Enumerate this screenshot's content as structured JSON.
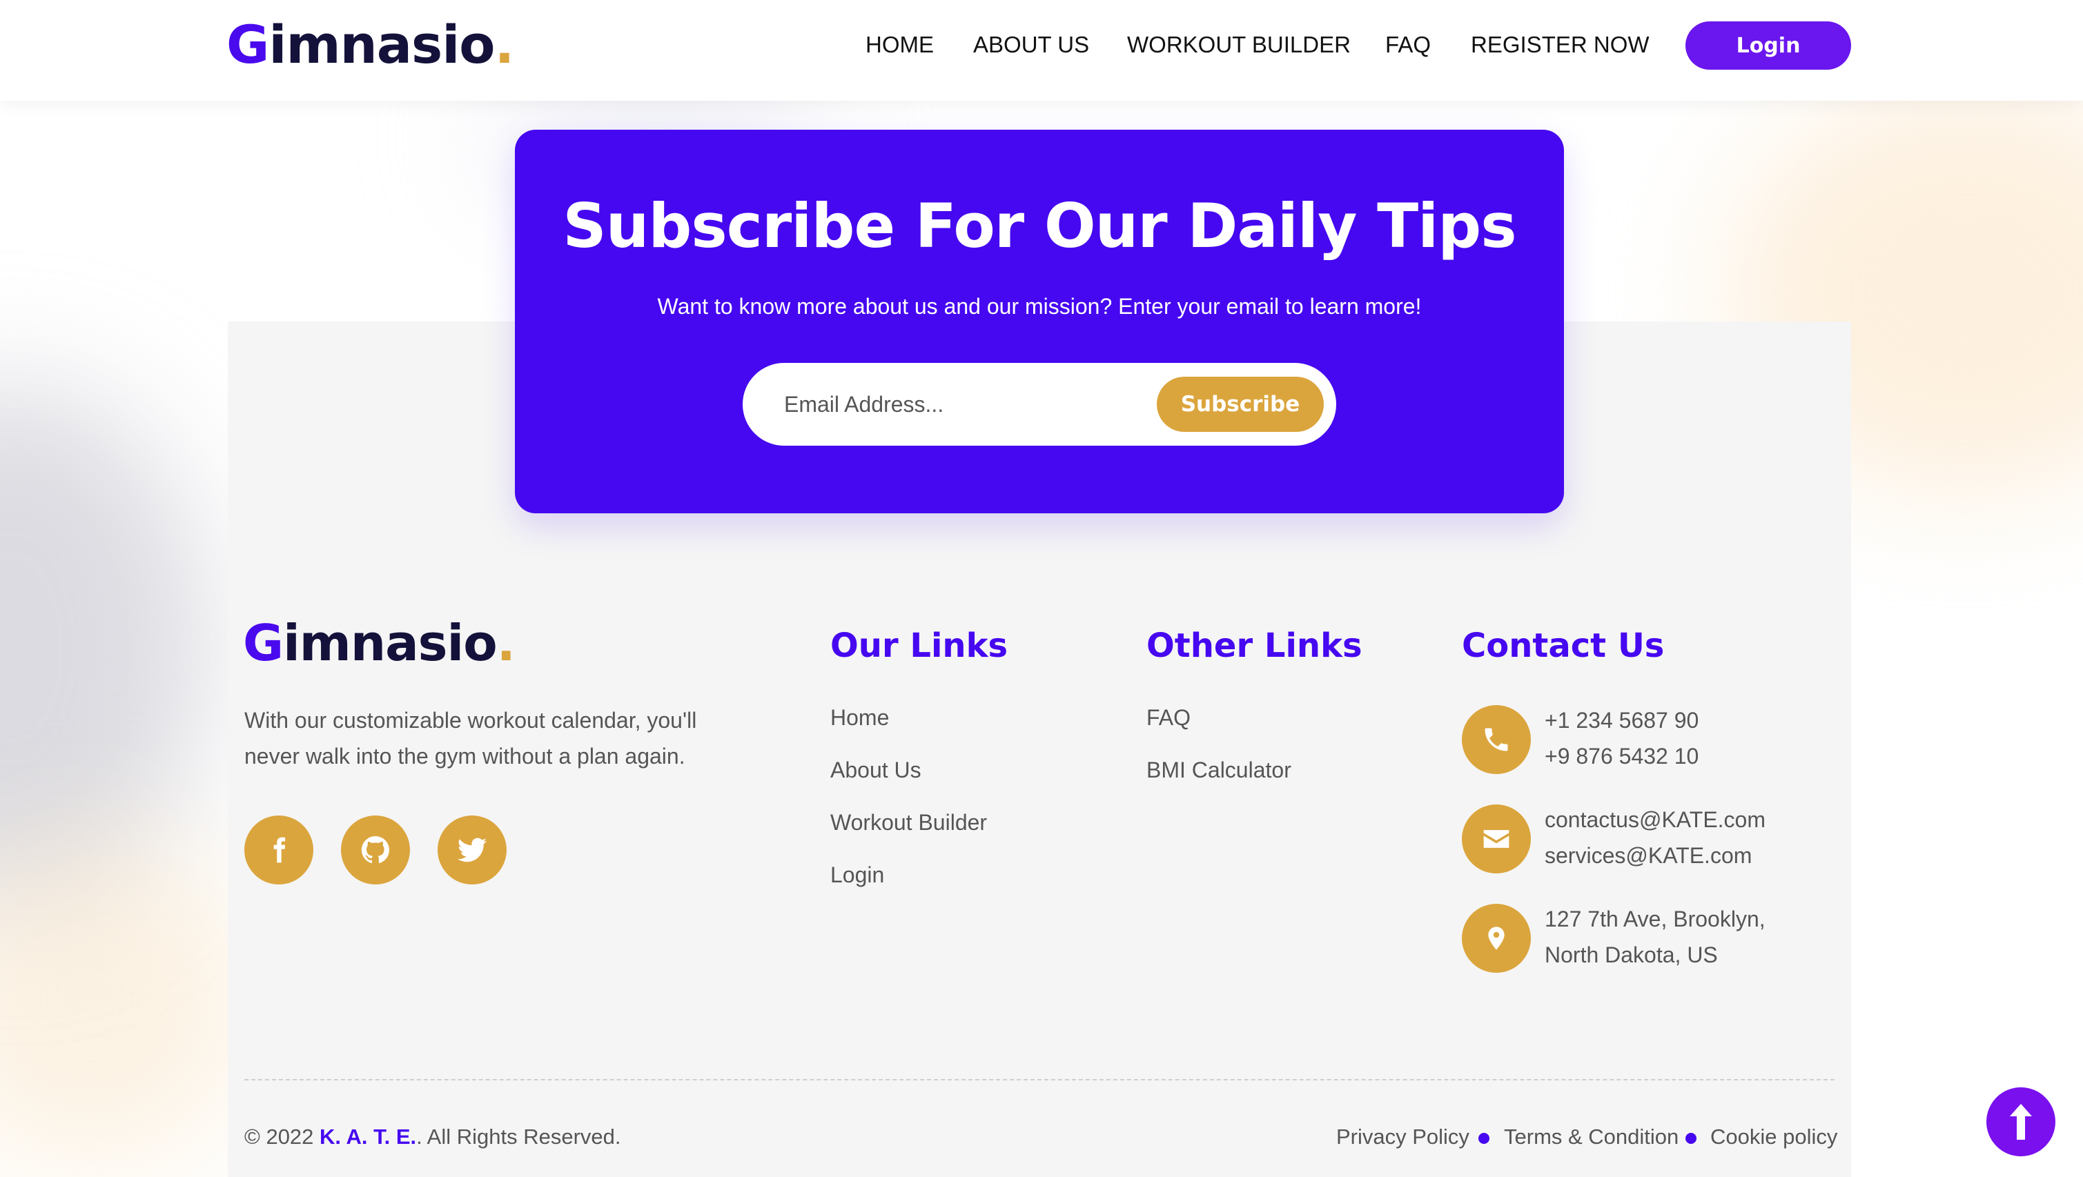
{
  "brand": {
    "logo_first": "G",
    "logo_rest": "imnasio",
    "logo_dot": "."
  },
  "nav": {
    "items": [
      "HOME",
      "ABOUT US",
      "WORKOUT BUILDER",
      "FAQ",
      "REGISTER NOW"
    ],
    "login_label": "Login"
  },
  "subscribe": {
    "title": "Subscribe For Our Daily Tips",
    "text": "Want to know more about us and our mission? Enter your email to learn more!",
    "email_placeholder": "Email Address...",
    "button_label": "Subscribe"
  },
  "footer": {
    "about_text": "With our customizable workout calendar, you'll never walk into the gym without a plan again.",
    "social_icons": [
      "facebook-icon",
      "github-icon",
      "twitter-icon"
    ],
    "our_links": {
      "title": "Our Links",
      "items": [
        "Home",
        "About Us",
        "Workout Builder",
        "Login"
      ]
    },
    "other_links": {
      "title": "Other Links",
      "items": [
        "FAQ",
        "BMI Calculator"
      ]
    },
    "contact": {
      "title": "Contact Us",
      "phones": [
        "+1 234 5687 90",
        "+9 876 5432 10"
      ],
      "emails": [
        "contactus@KATE.com",
        "services@KATE.com"
      ],
      "address": [
        "127 7th Ave, Brooklyn,",
        "North Dakota, US"
      ]
    },
    "copyright_prefix": "© 2022",
    "copyright_brand": "K. A. T. E.",
    "copyright_suffix": ". All Rights Reserved.",
    "legal": [
      "Privacy Policy",
      "Terms & Condition",
      "Cookie policy"
    ]
  },
  "colors": {
    "primary": "#4608f0",
    "accent": "#dba53d",
    "login_button": "#6a16ee",
    "scroll_top": "#7a10ee"
  }
}
